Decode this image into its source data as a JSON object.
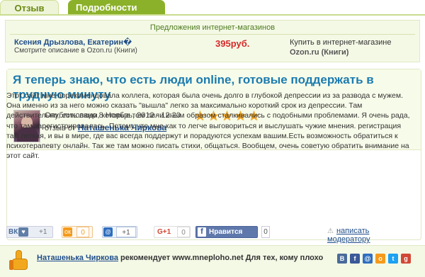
{
  "tabs": {
    "review": "Отзыв",
    "details": "Подробности"
  },
  "offers": {
    "title": "Предложения интернет-магазинов",
    "item": {
      "name": "Ксения Дрызлова, Екатерин�",
      "desc": "Смотрите описание в Ozon.ru (Книги)",
      "price": "395руб.",
      "buy_label": "Купить в интернет-магазине",
      "shop": "Ozon.ru (Книги)"
    }
  },
  "review": {
    "title": "Я теперь знаю, что есть люди online, готовые поддержать в трудную минуту",
    "published": "Опубликовано 8 Ноябрь, 2012 - 12:20",
    "by_label": "отзыв от",
    "author": "Наташенька Чиркова",
    "rating": 5,
    "body": "Этот сайт мне порекомендовала коллега, которая была очень долго в глубокой депрессии из за развода с мужем. Она именно из за него можно сказать \"вышла\" легко за максимально короткий срок из депрессии. Там действительно, есть люди, которые тем лили иным образом сталкивались с подобными проблемами. Я очень рада, что там зарегистрировалась. Потому что мне как то легче выговориться и выслушать чужие мнения. регистрация там легкая, и вы в мире, где вас всегда поддержут и порадуются успехам вашим.Есть возможность обратиться к психотерапевту онлайн. Так же там можно писать стихи, общаться. Вообщем, очень советую обратить внимание на этот сайт."
  },
  "social": {
    "vk_label": "ВК",
    "vk_count": "+1",
    "ok_count": "0",
    "mail_count": "+1",
    "gplus_label": "G+1",
    "gplus_count": "0",
    "fb_label": "Нравится",
    "fb_count": "0",
    "report_link": "написать модератору"
  },
  "recommend": {
    "author": "Наташенька Чиркова",
    "text": " рекомендует www.mneploho.net Для тех, кому плохо"
  },
  "colors": {
    "accent_green": "#8bb12a",
    "title_blue": "#1b7bb0",
    "price_red": "#d62a2a",
    "star": "#f5a623"
  }
}
